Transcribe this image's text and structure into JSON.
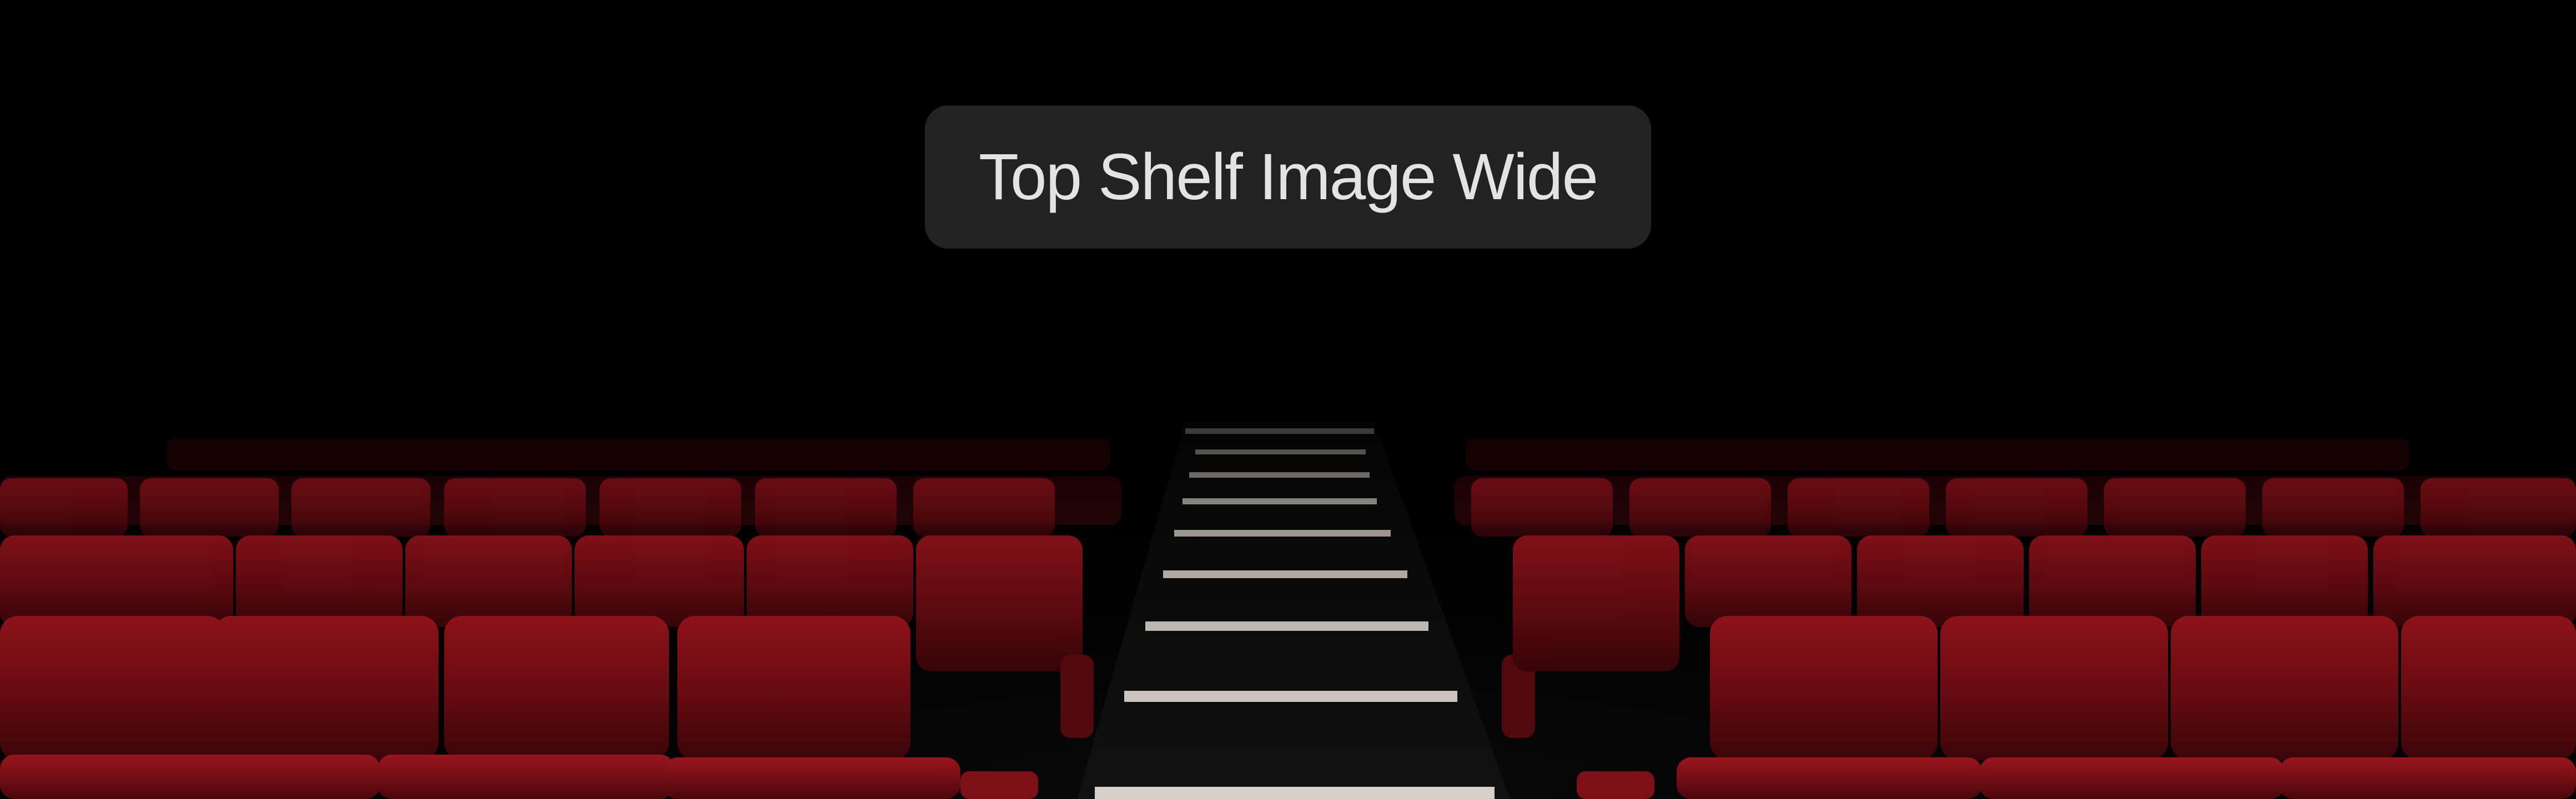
{
  "overlay": {
    "title": "Top Shelf Image Wide"
  },
  "image": {
    "subject": "theater-seating",
    "colors": {
      "background": "#000000",
      "seat_dark": "#360407",
      "seat_mid": "#5c0a10",
      "seat_light": "#8c1218",
      "step_edge": "#c8c1b8",
      "pill_bg": "#2a2a2a",
      "title_text": "#e3e3e3"
    }
  }
}
